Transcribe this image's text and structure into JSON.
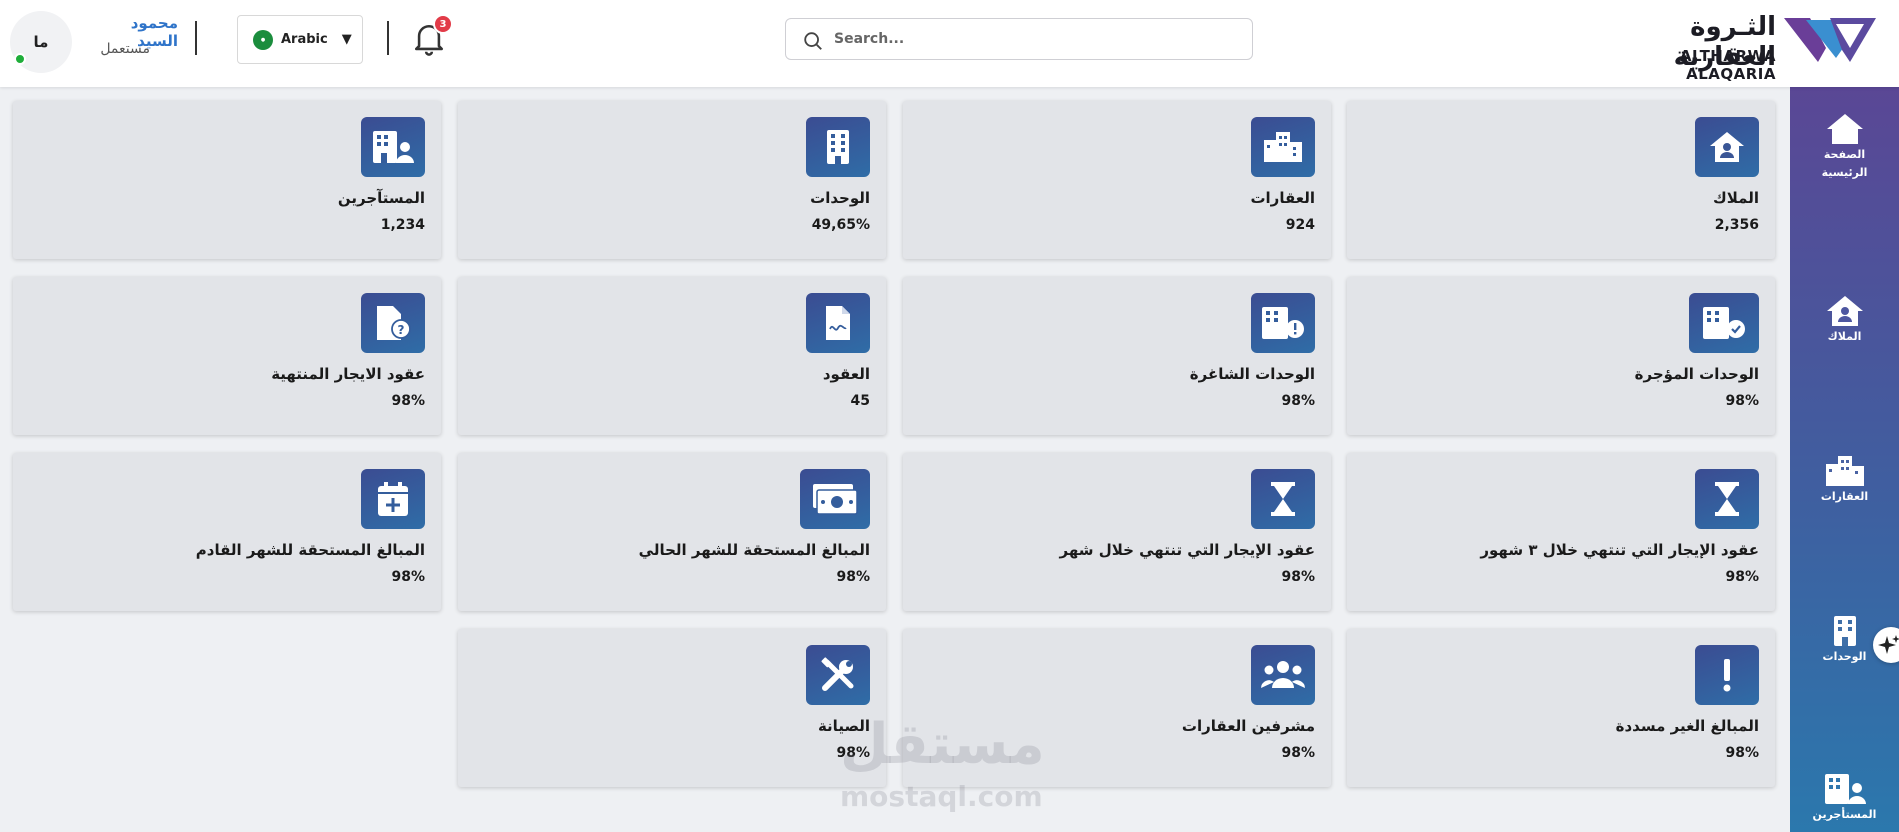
{
  "header": {
    "avatar_initials": "ما",
    "user_name": "محمود السيد",
    "user_role": "مستعمل",
    "language": "Arabic",
    "notifications_count": "3",
    "search_placeholder": "Search...",
    "brand_ar": "الثـروة العقارية",
    "brand_en": "ALTHARWA ALAQARIA"
  },
  "sidebar": {
    "items": [
      {
        "label": "الصفحة الرئيسية",
        "icon": "home-icon"
      },
      {
        "label": "الملاك",
        "icon": "owner-home-icon"
      },
      {
        "label": "العقارات",
        "icon": "buildings-icon"
      },
      {
        "label": "الوحدات",
        "icon": "building-icon"
      },
      {
        "label": "المستأجرين",
        "icon": "tenants-icon"
      }
    ]
  },
  "cards": [
    {
      "title": "الملاك",
      "value": "2,356",
      "icon": "owner-home-icon"
    },
    {
      "title": "العقارات",
      "value": "924",
      "icon": "city-icon"
    },
    {
      "title": "الوحدات",
      "value": "49,65%",
      "icon": "building-icon"
    },
    {
      "title": "المستآجرين",
      "value": "1,234",
      "icon": "tenant-building-icon"
    },
    {
      "title": "الوحدات المؤجرة",
      "value": "98%",
      "icon": "rented-units-icon"
    },
    {
      "title": "الوحدات الشاغرة",
      "value": "98%",
      "icon": "vacant-units-icon"
    },
    {
      "title": "العقود",
      "value": "45",
      "icon": "contract-icon"
    },
    {
      "title": "عقود الايجار المنتهية",
      "value": "98%",
      "icon": "expired-contract-icon"
    },
    {
      "title": "عقود الإيجار التي تنتهي خلال ٣ شهور",
      "value": "98%",
      "icon": "hourglass-icon"
    },
    {
      "title": "عقود الإيجار التي تنتهي خلال شهر",
      "value": "98%",
      "icon": "hourglass-icon"
    },
    {
      "title": "المبالغ المستحقة للشهر الحالي",
      "value": "98%",
      "icon": "money-icon"
    },
    {
      "title": "المبالغ المستحقة للشهر القادم",
      "value": "98%",
      "icon": "calendar-add-icon"
    },
    {
      "title": "المبالغ الغير مسددة",
      "value": "98%",
      "icon": "exclamation-icon"
    },
    {
      "title": "مشرفين العقارات",
      "value": "98%",
      "icon": "supervisors-icon"
    },
    {
      "title": "الصيانة",
      "value": "98%",
      "icon": "maintenance-icon"
    }
  ],
  "watermark": {
    "ar": "مستقل",
    "en": "mostaql.com"
  },
  "colors": {
    "sidebar_top": "#5a4795",
    "sidebar_bottom": "#2b78ad",
    "accent": "#2f74c9"
  }
}
